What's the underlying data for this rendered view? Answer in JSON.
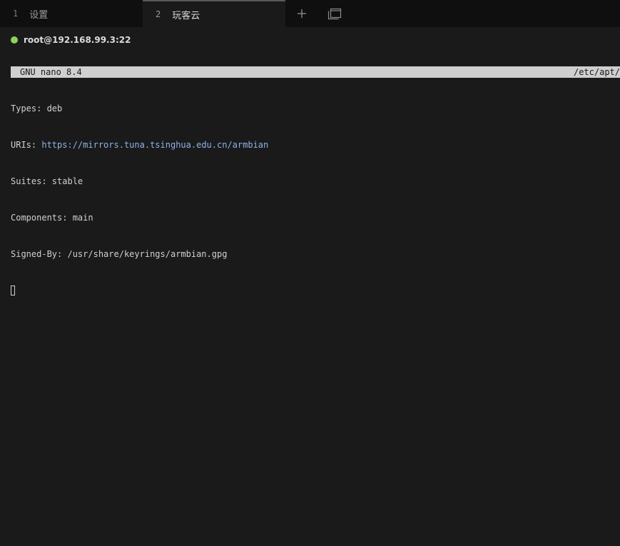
{
  "tabs": [
    {
      "number": "1",
      "label": "设置",
      "active": false
    },
    {
      "number": "2",
      "label": "玩客云",
      "active": true
    }
  ],
  "tab_actions": {
    "new_tab_icon": "plus-icon",
    "window_icon": "window-stack-icon"
  },
  "connection": {
    "status_color": "#8bd25a",
    "label": "root@192.168.99.3:22"
  },
  "nano": {
    "title": "GNU nano 8.4",
    "file_path": "/etc/apt/"
  },
  "file_lines": {
    "types_key": "Types: ",
    "types_value": "deb",
    "uris_key": "URIs: ",
    "uris_value": "https://mirrors.tuna.tsinghua.edu.cn/armbian",
    "suites": "Suites: stable",
    "components": "Components: main",
    "signed_by": "Signed-By: /usr/share/keyrings/armbian.gpg"
  }
}
